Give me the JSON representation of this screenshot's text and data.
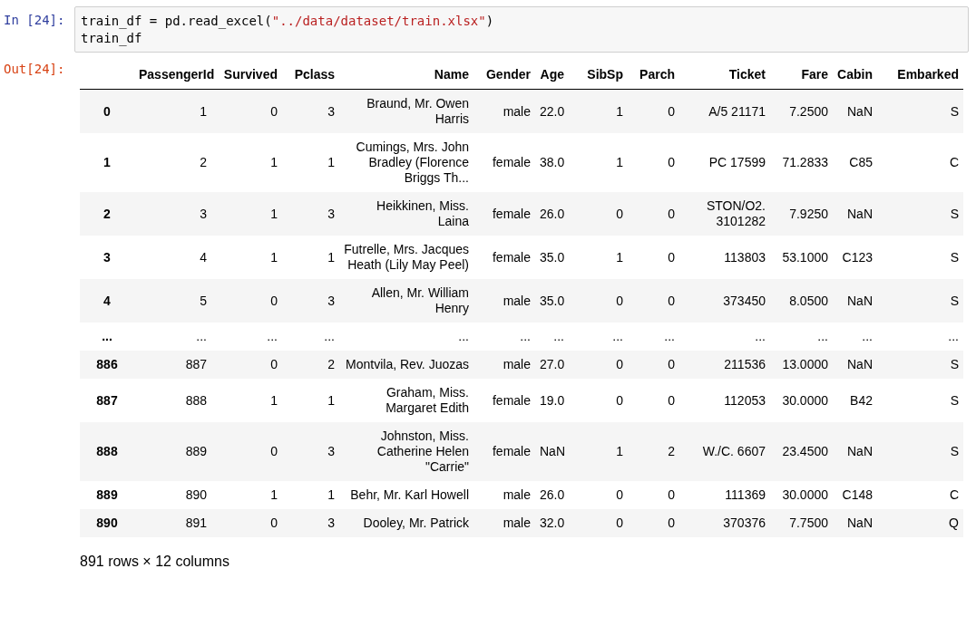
{
  "input_prompt": "In [24]:",
  "code": [
    [
      {
        "kind": "plain",
        "text": "train_df = pd.read_excel("
      },
      {
        "kind": "string",
        "text": "\"../data/dataset/train.xlsx\""
      },
      {
        "kind": "plain",
        "text": ")"
      }
    ],
    [
      {
        "kind": "plain",
        "text": "train_df"
      }
    ]
  ],
  "output_prompt": "Out[24]:",
  "table": {
    "columns": [
      "PassengerId",
      "Survived",
      "Pclass",
      "Name",
      "Gender",
      "Age",
      "SibSp",
      "Parch",
      "Ticket",
      "Fare",
      "Cabin",
      "Embarked"
    ],
    "rows": [
      {
        "index": "0",
        "cells": [
          "1",
          "0",
          "3",
          "Braund, Mr. Owen Harris",
          "male",
          "22.0",
          "1",
          "0",
          "A/5 21171",
          "7.2500",
          "NaN",
          "S"
        ]
      },
      {
        "index": "1",
        "cells": [
          "2",
          "1",
          "1",
          "Cumings, Mrs. John Bradley (Florence Briggs Th...",
          "female",
          "38.0",
          "1",
          "0",
          "PC 17599",
          "71.2833",
          "C85",
          "C"
        ]
      },
      {
        "index": "2",
        "cells": [
          "3",
          "1",
          "3",
          "Heikkinen, Miss. Laina",
          "female",
          "26.0",
          "0",
          "0",
          "STON/O2. 3101282",
          "7.9250",
          "NaN",
          "S"
        ]
      },
      {
        "index": "3",
        "cells": [
          "4",
          "1",
          "1",
          "Futrelle, Mrs. Jacques Heath (Lily May Peel)",
          "female",
          "35.0",
          "1",
          "0",
          "113803",
          "53.1000",
          "C123",
          "S"
        ]
      },
      {
        "index": "4",
        "cells": [
          "5",
          "0",
          "3",
          "Allen, Mr. William Henry",
          "male",
          "35.0",
          "0",
          "0",
          "373450",
          "8.0500",
          "NaN",
          "S"
        ]
      },
      {
        "index": "...",
        "cells": [
          "...",
          "...",
          "...",
          "...",
          "...",
          "...",
          "...",
          "...",
          "...",
          "...",
          "...",
          "..."
        ]
      },
      {
        "index": "886",
        "cells": [
          "887",
          "0",
          "2",
          "Montvila, Rev. Juozas",
          "male",
          "27.0",
          "0",
          "0",
          "211536",
          "13.0000",
          "NaN",
          "S"
        ]
      },
      {
        "index": "887",
        "cells": [
          "888",
          "1",
          "1",
          "Graham, Miss. Margaret Edith",
          "female",
          "19.0",
          "0",
          "0",
          "112053",
          "30.0000",
          "B42",
          "S"
        ]
      },
      {
        "index": "888",
        "cells": [
          "889",
          "0",
          "3",
          "Johnston, Miss. Catherine Helen \"Carrie\"",
          "female",
          "NaN",
          "1",
          "2",
          "W./C. 6607",
          "23.4500",
          "NaN",
          "S"
        ]
      },
      {
        "index": "889",
        "cells": [
          "890",
          "1",
          "1",
          "Behr, Mr. Karl Howell",
          "male",
          "26.0",
          "0",
          "0",
          "111369",
          "30.0000",
          "C148",
          "C"
        ]
      },
      {
        "index": "890",
        "cells": [
          "891",
          "0",
          "3",
          "Dooley, Mr. Patrick",
          "male",
          "32.0",
          "0",
          "0",
          "370376",
          "7.7500",
          "NaN",
          "Q"
        ]
      }
    ]
  },
  "footer": "891 rows × 12 columns"
}
